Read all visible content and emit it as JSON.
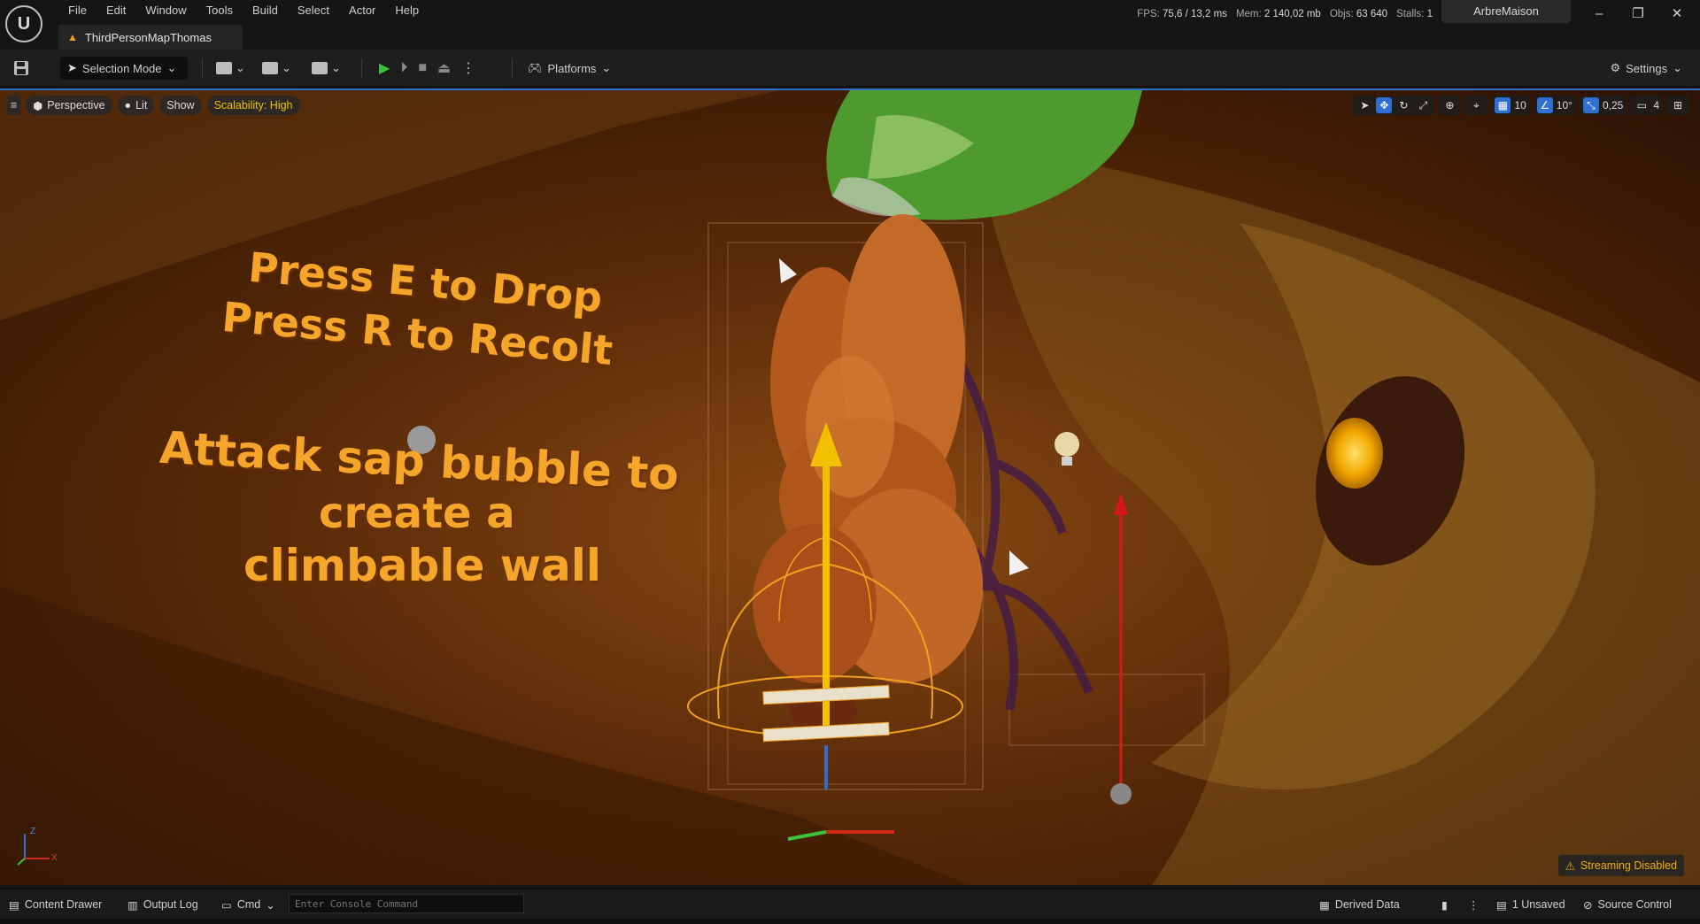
{
  "menu": [
    "File",
    "Edit",
    "Window",
    "Tools",
    "Build",
    "Select",
    "Actor",
    "Help"
  ],
  "document_tab": "ThirdPersonMapThomas",
  "stats": {
    "fps_label": "FPS:",
    "fps_value": "75,6",
    "ms_value": "/ 13,2 ms",
    "mem_label": "Mem:",
    "mem_value": "2 140,02 mb",
    "objs_label": "Objs:",
    "objs_value": "63 640",
    "stalls_label": "Stalls:",
    "stalls_value": "1"
  },
  "project_tab": "ArbreMaison",
  "window_controls": {
    "minimize": "–",
    "restore": "❐",
    "close": "✕"
  },
  "toolbar": {
    "selection_mode": "Selection Mode",
    "platforms": "Platforms",
    "settings": "Settings"
  },
  "viewport": {
    "perspective": "Perspective",
    "lit": "Lit",
    "show": "Show",
    "scalability": "Scalability: High",
    "grid_snap": "10",
    "rotation_snap": "10°",
    "scale_snap": "0,25",
    "camera_speed": "4",
    "streaming": "Streaming Disabled",
    "axis_z": "Z",
    "axis_x": "X",
    "in_world_text": {
      "line1": "Press E to Drop",
      "line2": "Press R to Recolt",
      "line3": "Attack sap bubble to",
      "line4": "create a",
      "line5": "climbable wall"
    }
  },
  "statusbar": {
    "content_drawer": "Content Drawer",
    "output_log": "Output Log",
    "cmd": "Cmd",
    "console_placeholder": "Enter Console Command",
    "derived_data": "Derived Data",
    "unsaved": "1 Unsaved",
    "source_control": "Source Control"
  },
  "colors": {
    "accent_blue": "#2f6fd0",
    "warning_yellow": "#f0b000",
    "in_world_text": "#f4a52a"
  }
}
